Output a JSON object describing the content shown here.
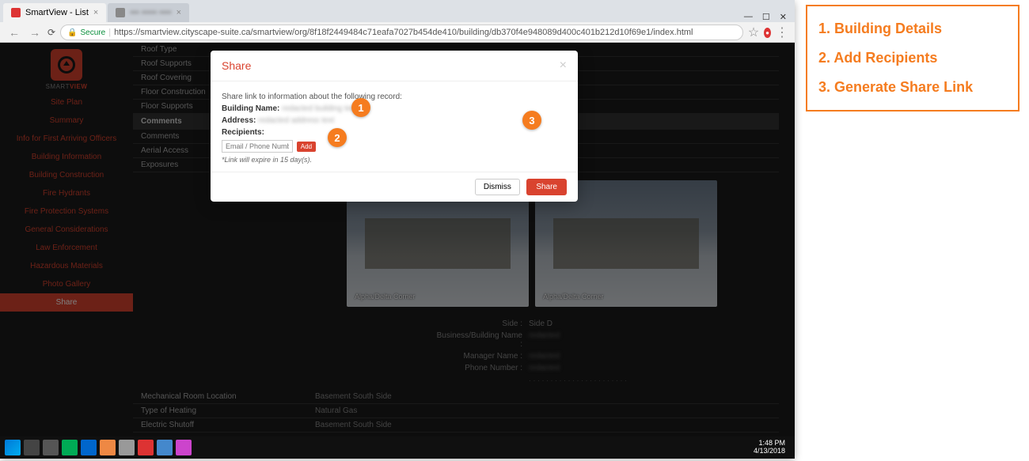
{
  "browser": {
    "tab_title": "SmartView - List",
    "secure_label": "Secure",
    "url": "https://smartview.cityscape-suite.ca/smartview/org/8f18f2449484c71eafa7027b454de410/building/db370f4e948089d400c401b212d10f69e1/index.html"
  },
  "logo": {
    "brand_a": "SMART",
    "brand_b": "VIEW"
  },
  "sidebar": {
    "items": [
      {
        "label": "Site Plan"
      },
      {
        "label": "Summary"
      },
      {
        "label": "Info for First Arriving Officers"
      },
      {
        "label": "Building Information"
      },
      {
        "label": "Building Construction"
      },
      {
        "label": "Fire Hydrants"
      },
      {
        "label": "Fire Protection Systems"
      },
      {
        "label": "General Considerations"
      },
      {
        "label": "Law Enforcement"
      },
      {
        "label": "Hazardous Materials"
      },
      {
        "label": "Photo Gallery"
      },
      {
        "label": "Share"
      }
    ],
    "active_index": 11
  },
  "details": {
    "rows_top": [
      {
        "label": "Roof Type"
      },
      {
        "label": "Roof Supports"
      },
      {
        "label": "Roof Covering"
      },
      {
        "label": "Floor Construction"
      },
      {
        "label": "Floor Supports"
      }
    ],
    "comments_header": "Comments",
    "rows_mid": [
      {
        "label": "Comments"
      },
      {
        "label": "Aerial Access"
      },
      {
        "label": "Exposures"
      }
    ],
    "photo_caption_a": "Alpha/Delta Corner",
    "photo_caption_b": "Alpha/Delta Corner",
    "info_block": [
      {
        "label": "Side :",
        "value": "Side D"
      },
      {
        "label": "Business/Building Name :",
        "value": "redacted"
      },
      {
        "label": "Manager Name :",
        "value": "redacted"
      },
      {
        "label": "Phone Number :",
        "value": "redacted"
      }
    ],
    "rows_bottom": [
      {
        "label": "Mechanical Room Location",
        "value": "Basement South Side"
      },
      {
        "label": "Type of Heating",
        "value": "Natural Gas"
      },
      {
        "label": "Electric Shutoff",
        "value": "Basement South Side"
      }
    ]
  },
  "modal": {
    "title": "Share",
    "intro": "Share link to information about the following record:",
    "building_label": "Building Name:",
    "building_value": "redacted building text",
    "address_label": "Address:",
    "address_value": "redacted address text",
    "recipients_label": "Recipients:",
    "input_placeholder": "Email / Phone Number",
    "add_btn": "Add",
    "expire_note": "*Link will expire in 15 day(s).",
    "dismiss": "Dismiss",
    "share": "Share"
  },
  "callouts": {
    "c1": "1",
    "c2": "2",
    "c3": "3"
  },
  "taskbar": {
    "time": "1:48 PM",
    "date": "4/13/2018"
  },
  "legend": {
    "items": [
      "1. Building Details",
      "2. Add Recipients",
      "3. Generate Share Link"
    ]
  }
}
